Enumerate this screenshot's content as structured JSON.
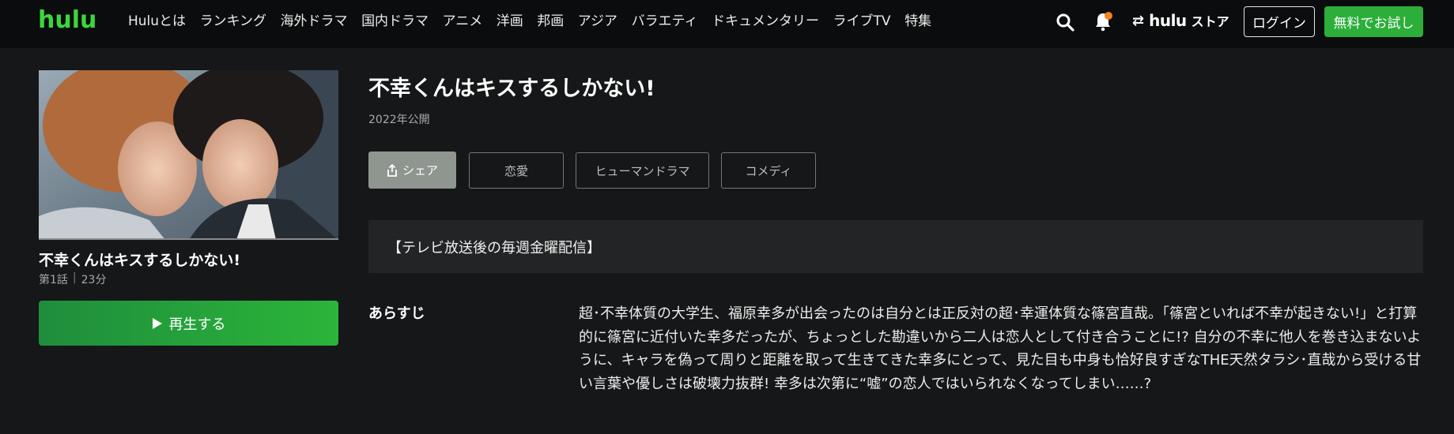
{
  "header": {
    "logo": "hulu",
    "nav": [
      "Huluとは",
      "ランキング",
      "海外ドラマ",
      "国内ドラマ",
      "アニメ",
      "洋画",
      "邦画",
      "アジア",
      "バラエティ",
      "ドキュメンタリー",
      "ライブTV",
      "特集"
    ],
    "store_logo": "hulu",
    "store_text": "ストア",
    "login_label": "ログイン",
    "trial_label": "無料でお試し",
    "icons": {
      "search": "search-icon",
      "notifications": "bell-icon",
      "switch": "swap-arrows-icon"
    },
    "colors": {
      "brand": "#3cd63c",
      "notification_dot": "#f5821f",
      "trial_button": "#2cae3a"
    }
  },
  "episode": {
    "title": "不幸くんはキスするしかない!",
    "number": "第1話",
    "duration": "23分",
    "separator": "|",
    "play_label": "再生する"
  },
  "show": {
    "title": "不幸くんはキスするしかない!",
    "year": "2022年公開",
    "share_label": "シェア",
    "tags": [
      "恋愛",
      "ヒューマンドラマ",
      "コメディ"
    ],
    "notice": "【テレビ放送後の毎週金曜配信】",
    "synopsis_label": "あらすじ",
    "synopsis": "超･不幸体質の大学生、福原幸多が出会ったのは自分とは正反対の超･幸運体質な篠宮直哉。「篠宮といれば不幸が起きない!」と打算的に篠宮に近付いた幸多だったが、ちょっとした勘違いから二人は恋人として付き合うことに!? 自分の不幸に他人を巻き込まないように、キャラを偽って周りと距離を取って生きてきた幸多にとって、見た目も中身も恰好良すぎなTHE天然タラシ･直哉から受ける甘い言葉や優しさは破壊力抜群! 幸多は次第に“嘘”の恋人ではいられなくなってしまい……?"
  }
}
